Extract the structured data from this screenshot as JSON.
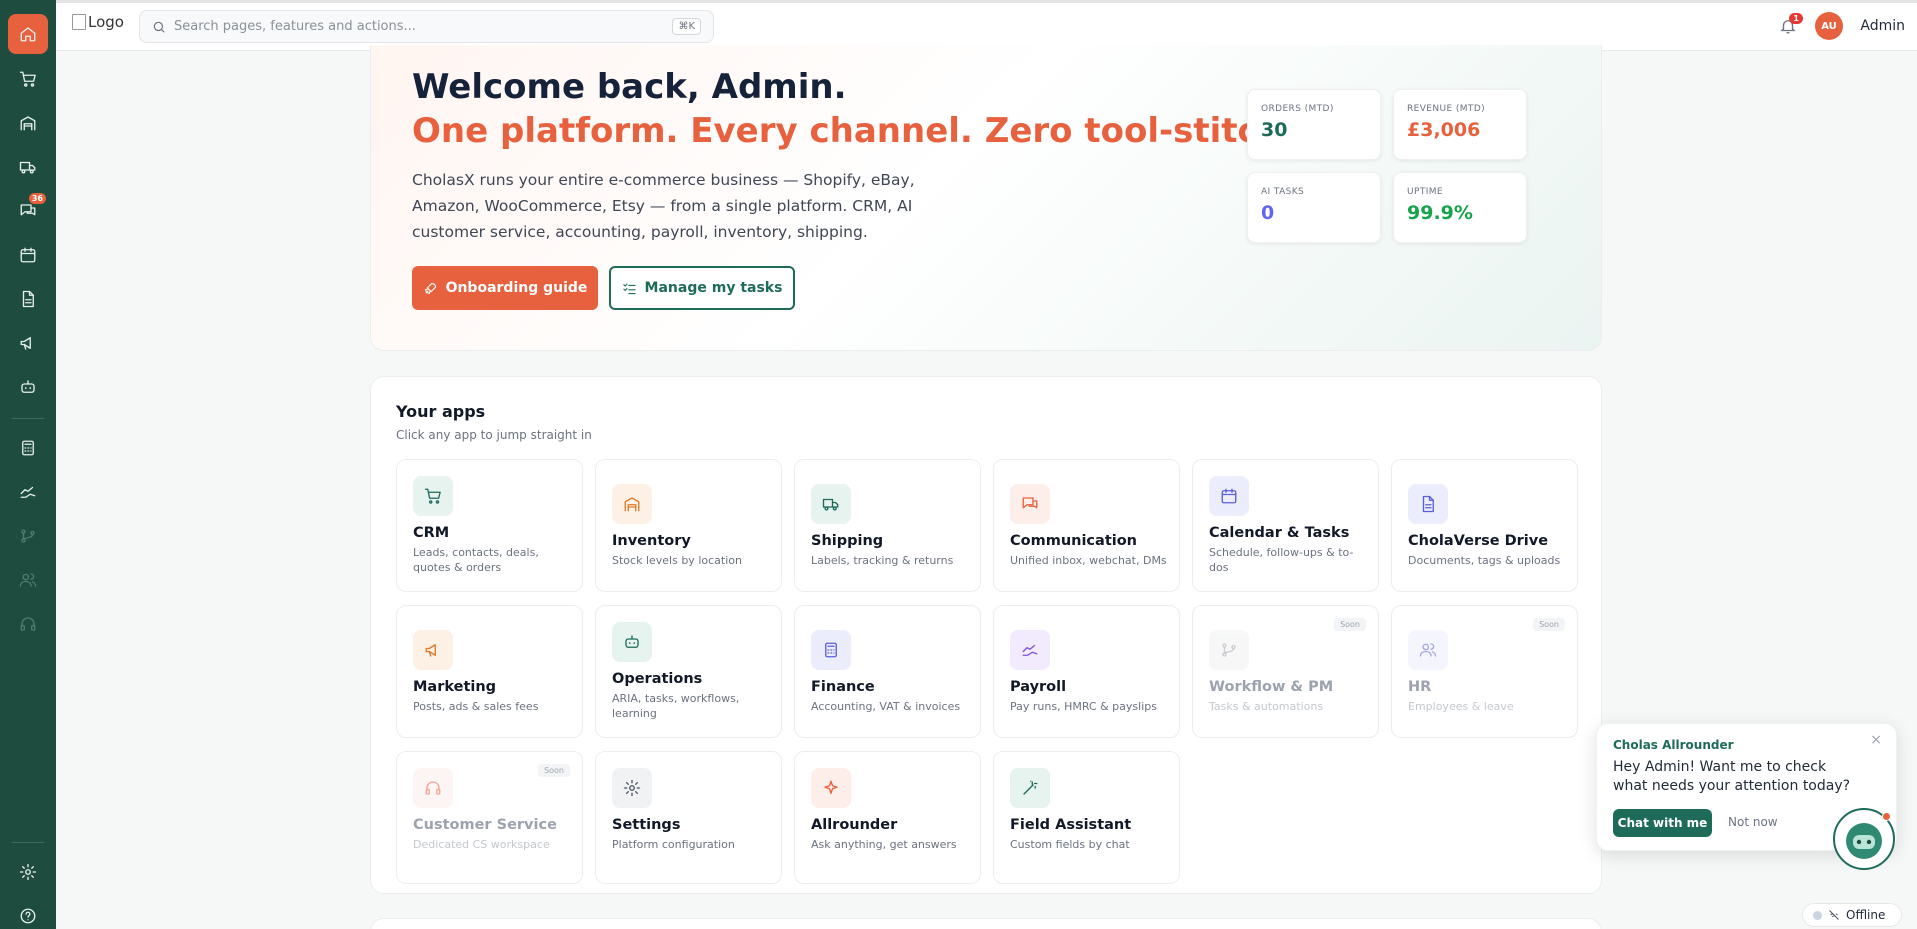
{
  "header": {
    "logo_alt": "Logo",
    "search_placeholder": "Search pages, features and actions...",
    "search_shortcut": "⌘K",
    "notification_count": "1",
    "avatar_initials": "AU",
    "user_name": "Admin"
  },
  "sidebar": {
    "messages_badge": "36",
    "items": [
      "home-icon",
      "cart-icon",
      "warehouse-icon",
      "truck-icon",
      "chat-icon",
      "calendar-icon",
      "document-icon",
      "megaphone-icon",
      "bot-icon",
      "calculator-icon",
      "payroll-icon",
      "workflow-icon",
      "users-icon",
      "headset-icon",
      "gear-icon",
      "help-icon"
    ]
  },
  "hero": {
    "title": "Welcome back, Admin.",
    "tagline": "One platform. Every channel. Zero tool-stitching.",
    "description": "CholasX runs your entire e-commerce business — Shopify, eBay, Amazon, WooCommerce, Etsy — from a single platform. CRM, AI customer service, accounting, payroll, inventory, shipping.",
    "primary_button": "Onboarding guide",
    "secondary_button": "Manage my tasks",
    "stats": [
      {
        "label": "ORDERS (MTD)",
        "value": "30",
        "color": "#1e6b5a"
      },
      {
        "label": "REVENUE (MTD)",
        "value": "£3,006",
        "color": "#e8613f"
      },
      {
        "label": "AI TASKS",
        "value": "0",
        "color": "#6366f1"
      },
      {
        "label": "UPTIME",
        "value": "99.9%",
        "color": "#16a34a"
      }
    ]
  },
  "apps": {
    "title": "Your apps",
    "subtitle": "Click any app to jump straight in",
    "soon_label": "Soon",
    "tiles": [
      {
        "name": "CRM",
        "desc": "Leads, contacts, deals, quotes & orders"
      },
      {
        "name": "Inventory",
        "desc": "Stock levels by location"
      },
      {
        "name": "Shipping",
        "desc": "Labels, tracking & returns"
      },
      {
        "name": "Communication",
        "desc": "Unified inbox, webchat, DMs"
      },
      {
        "name": "Calendar & Tasks",
        "desc": "Schedule, follow-ups & to-dos"
      },
      {
        "name": "CholaVerse Drive",
        "desc": "Documents, tags & uploads"
      },
      {
        "name": "Marketing",
        "desc": "Posts, ads & sales fees"
      },
      {
        "name": "Operations",
        "desc": "ARIA, tasks, workflows, learning"
      },
      {
        "name": "Finance",
        "desc": "Accounting, VAT & invoices"
      },
      {
        "name": "Payroll",
        "desc": "Pay runs, HMRC & payslips"
      },
      {
        "name": "Workflow & PM",
        "desc": "Tasks & automations"
      },
      {
        "name": "HR",
        "desc": "Employees & leave"
      },
      {
        "name": "Customer Service",
        "desc": "Dedicated CS workspace"
      },
      {
        "name": "Settings",
        "desc": "Platform configuration"
      },
      {
        "name": "Allrounder",
        "desc": "Ask anything, get answers"
      },
      {
        "name": "Field Assistant",
        "desc": "Custom fields by chat"
      }
    ]
  },
  "chat": {
    "name": "Cholas Allrounder",
    "message": "Hey Admin! Want me to check what needs your attention today?",
    "accept": "Chat with me",
    "dismiss": "Not now",
    "close": "×"
  },
  "status": {
    "connection": "Offline"
  },
  "colors": {
    "sidebar": "#1e4d40",
    "accent": "#e8613f",
    "brand_green": "#1e6b5a"
  }
}
